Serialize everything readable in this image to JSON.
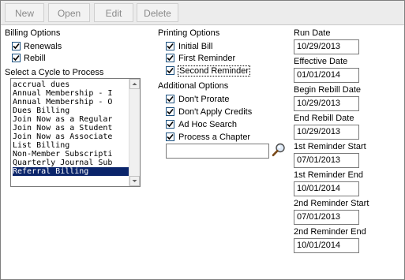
{
  "toolbar": {
    "new_label": "New",
    "open_label": "Open",
    "edit_label": "Edit",
    "delete_label": "Delete"
  },
  "billing_options": {
    "title": "Billing Options",
    "renewals_label": "Renewals",
    "renewals_checked": true,
    "rebill_label": "Rebill",
    "rebill_checked": true
  },
  "cycle": {
    "title": "Select a Cycle to Process",
    "items": [
      "accrual dues",
      "Annual Membership - I",
      "Annual Membership - O",
      "Dues Billing",
      "Join Now as a Regular",
      "Join Now as a Student",
      "Join Now as Associate",
      "List Billing",
      "Non-Member Subscripti",
      "Quarterly Journal Sub",
      "Referral Billing"
    ],
    "selected": "Referral Billing"
  },
  "printing_options": {
    "title": "Printing Options",
    "initial_bill_label": "Initial Bill",
    "first_reminder_label": "First Reminder",
    "second_reminder_label": "Second Reminder"
  },
  "additional_options": {
    "title": "Additional Options",
    "dont_prorate_label": "Don't Prorate",
    "dont_apply_credits_label": "Don't Apply Credits",
    "ad_hoc_search_label": "Ad Hoc Search",
    "process_chapter_label": "Process a Chapter",
    "chapter_value": ""
  },
  "dates": {
    "run_date_label": "Run Date",
    "run_date": "10/29/2013",
    "effective_date_label": "Effective Date",
    "effective_date": "01/01/2014",
    "begin_rebill_label": "Begin Rebill Date",
    "begin_rebill": "10/29/2013",
    "end_rebill_label": "End Rebill Date",
    "end_rebill": "10/29/2013",
    "first_reminder_start_label": "1st Reminder Start",
    "first_reminder_start": "07/01/2013",
    "first_reminder_end_label": "1st Reminder End",
    "first_reminder_end": "10/01/2014",
    "second_reminder_start_label": "2nd Reminder Start",
    "second_reminder_start": "07/01/2013",
    "second_reminder_end_label": "2nd Reminder End",
    "second_reminder_end": "10/01/2014"
  },
  "icons": {
    "check": "check-icon",
    "search": "magnifier-search-icon",
    "scroll_up": "scroll-up-arrow-icon",
    "scroll_down": "scroll-down-arrow-icon"
  }
}
